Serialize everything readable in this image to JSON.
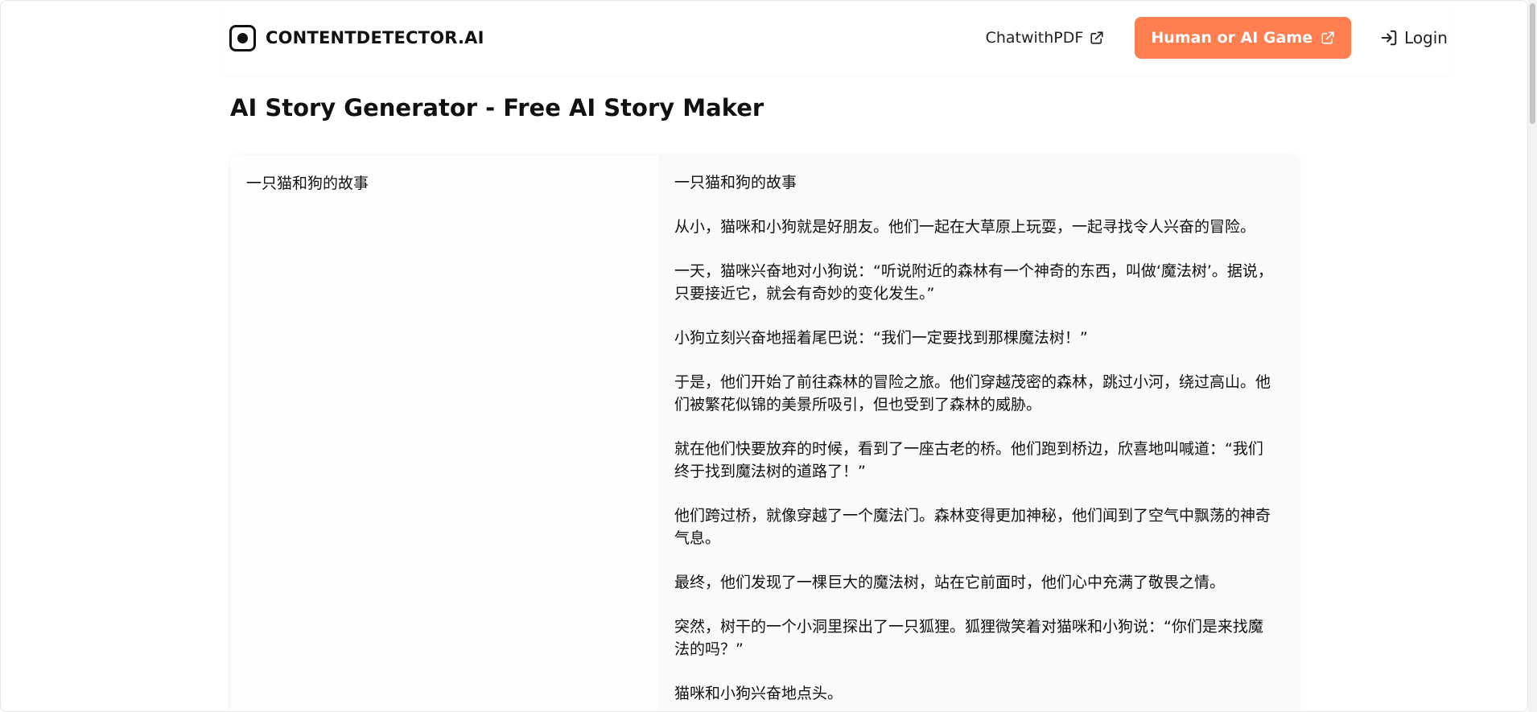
{
  "header": {
    "brand": "CONTENTDETECTOR.AI",
    "nav": {
      "chat_pdf": "ChatwithPDF",
      "game": "Human or AI Game",
      "login": "Login"
    }
  },
  "page": {
    "title": "AI Story Generator - Free AI Story Maker"
  },
  "input": {
    "text": "一只猫和狗的故事"
  },
  "output": {
    "paragraphs": [
      "一只猫和狗的故事",
      "从小，猫咪和小狗就是好朋友。他们一起在大草原上玩耍，一起寻找令人兴奋的冒险。",
      "一天，猫咪兴奋地对小狗说：“听说附近的森林有一个神奇的东西，叫做‘魔法树’。据说，只要接近它，就会有奇妙的变化发生。”",
      "小狗立刻兴奋地摇着尾巴说：“我们一定要找到那棵魔法树！”",
      "于是，他们开始了前往森林的冒险之旅。他们穿越茂密的森林，跳过小河，绕过高山。他们被繁花似锦的美景所吸引，但也受到了森林的威胁。",
      "就在他们快要放弃的时候，看到了一座古老的桥。他们跑到桥边，欣喜地叫喊道：“我们终于找到魔法树的道路了！”",
      "他们跨过桥，就像穿越了一个魔法门。森林变得更加神秘，他们闻到了空气中飘荡的神奇气息。",
      "最终，他们发现了一棵巨大的魔法树，站在它前面时，他们心中充满了敬畏之情。",
      "突然，树干的一个小洞里探出了一只狐狸。狐狸微笑着对猫咪和小狗说：“你们是来找魔法的吗？”",
      "猫咪和小狗兴奋地点头。"
    ]
  },
  "colors": {
    "accent": "#ff7f50"
  },
  "icons": {
    "logo": "record-icon",
    "external": "external-link-icon",
    "login": "login-icon"
  }
}
